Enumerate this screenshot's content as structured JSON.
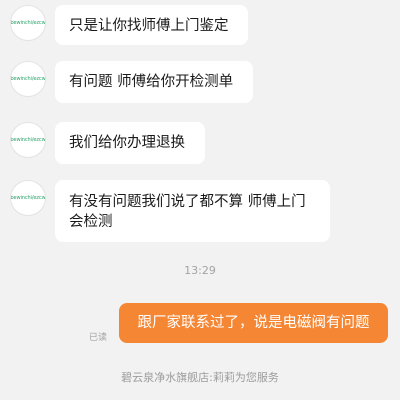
{
  "avatar": {
    "text": "bewinchi/ezcw",
    "color": "#2aa06a"
  },
  "messages_received": [
    {
      "text": "只是让你找师傅上门鉴定"
    },
    {
      "text": "有问题 师傅给你开检测单"
    },
    {
      "text": "我们给你办理退换"
    },
    {
      "line1": "有没有问题我们说了都不算 师傅上门",
      "line2": "会检测"
    }
  ],
  "timestamp": "13:29",
  "message_sent": {
    "text": "跟厂家联系过了，说是电磁阀有问题",
    "status": "已读",
    "color": "#f58634"
  },
  "system_note": "碧云泉净水旗舰店:莉莉为您服务"
}
